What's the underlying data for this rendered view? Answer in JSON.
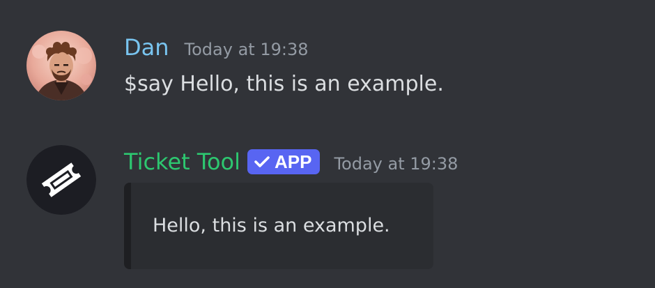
{
  "messages": [
    {
      "author": "Dan",
      "timestamp": "Today at 19:38",
      "text": "$say Hello, this is an example.",
      "author_color": "#79c5f0",
      "avatar": "user-avatar-portrait"
    },
    {
      "author": "Ticket Tool",
      "badge": "APP",
      "timestamp": "Today at 19:38",
      "embed_text": "Hello, this is an example.",
      "author_color": "#2dc770",
      "badge_color": "#5865f2",
      "avatar": "ticket-icon"
    }
  ],
  "theme": {
    "background": "#313338",
    "embed_background": "#2b2d31",
    "embed_bar": "#1e1f22",
    "timestamp_color": "#949ba4",
    "text_color": "#dbdee1"
  }
}
